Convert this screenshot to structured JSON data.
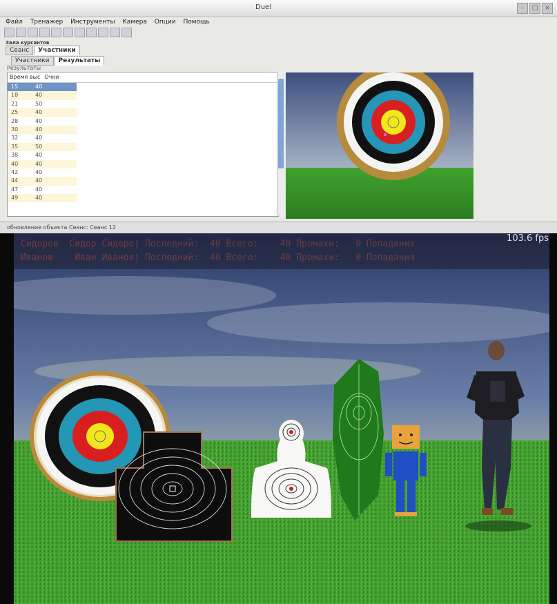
{
  "window": {
    "title": "Duel"
  },
  "menu": [
    "Файл",
    "Тренажер",
    "Инструменты",
    "Камера",
    "Опции",
    "Помощь"
  ],
  "panel_title": "Зала курсантов",
  "tabs": [
    "Сеанс",
    "Участники"
  ],
  "subtabs": [
    "Участники",
    "Результаты"
  ],
  "group_label": "Результаты",
  "table": {
    "headers": [
      "Время выс",
      "Очки"
    ],
    "rows": [
      [
        "15",
        "40"
      ],
      [
        "18",
        "40"
      ],
      [
        "21",
        "50"
      ],
      [
        "25",
        "40"
      ],
      [
        "28",
        "40"
      ],
      [
        "30",
        "40"
      ],
      [
        "32",
        "40"
      ],
      [
        "35",
        "50"
      ],
      [
        "38",
        "40"
      ],
      [
        "40",
        "40"
      ],
      [
        "42",
        "40"
      ],
      [
        "44",
        "40"
      ],
      [
        "47",
        "40"
      ],
      [
        "49",
        "40"
      ]
    ]
  },
  "status_text": "обновление объекта Сеанс: Сеанс 12",
  "viewport": {
    "fps": "103.6 fps",
    "hud": [
      {
        "name": "Сидоров  Сидор Сидоро|",
        "stats": " Последний:  40 Всего:    40 Промахи:   0 Попадания"
      },
      {
        "name": "Иванов    Иван Иванов|",
        "stats": " Последний:  40 Всего:    40 Промахи:   0 Попадания"
      }
    ]
  },
  "colors": {
    "accent": "#7fa6d6",
    "row_alt": "#fdf6d8",
    "row_selected": "#6f94c8"
  }
}
